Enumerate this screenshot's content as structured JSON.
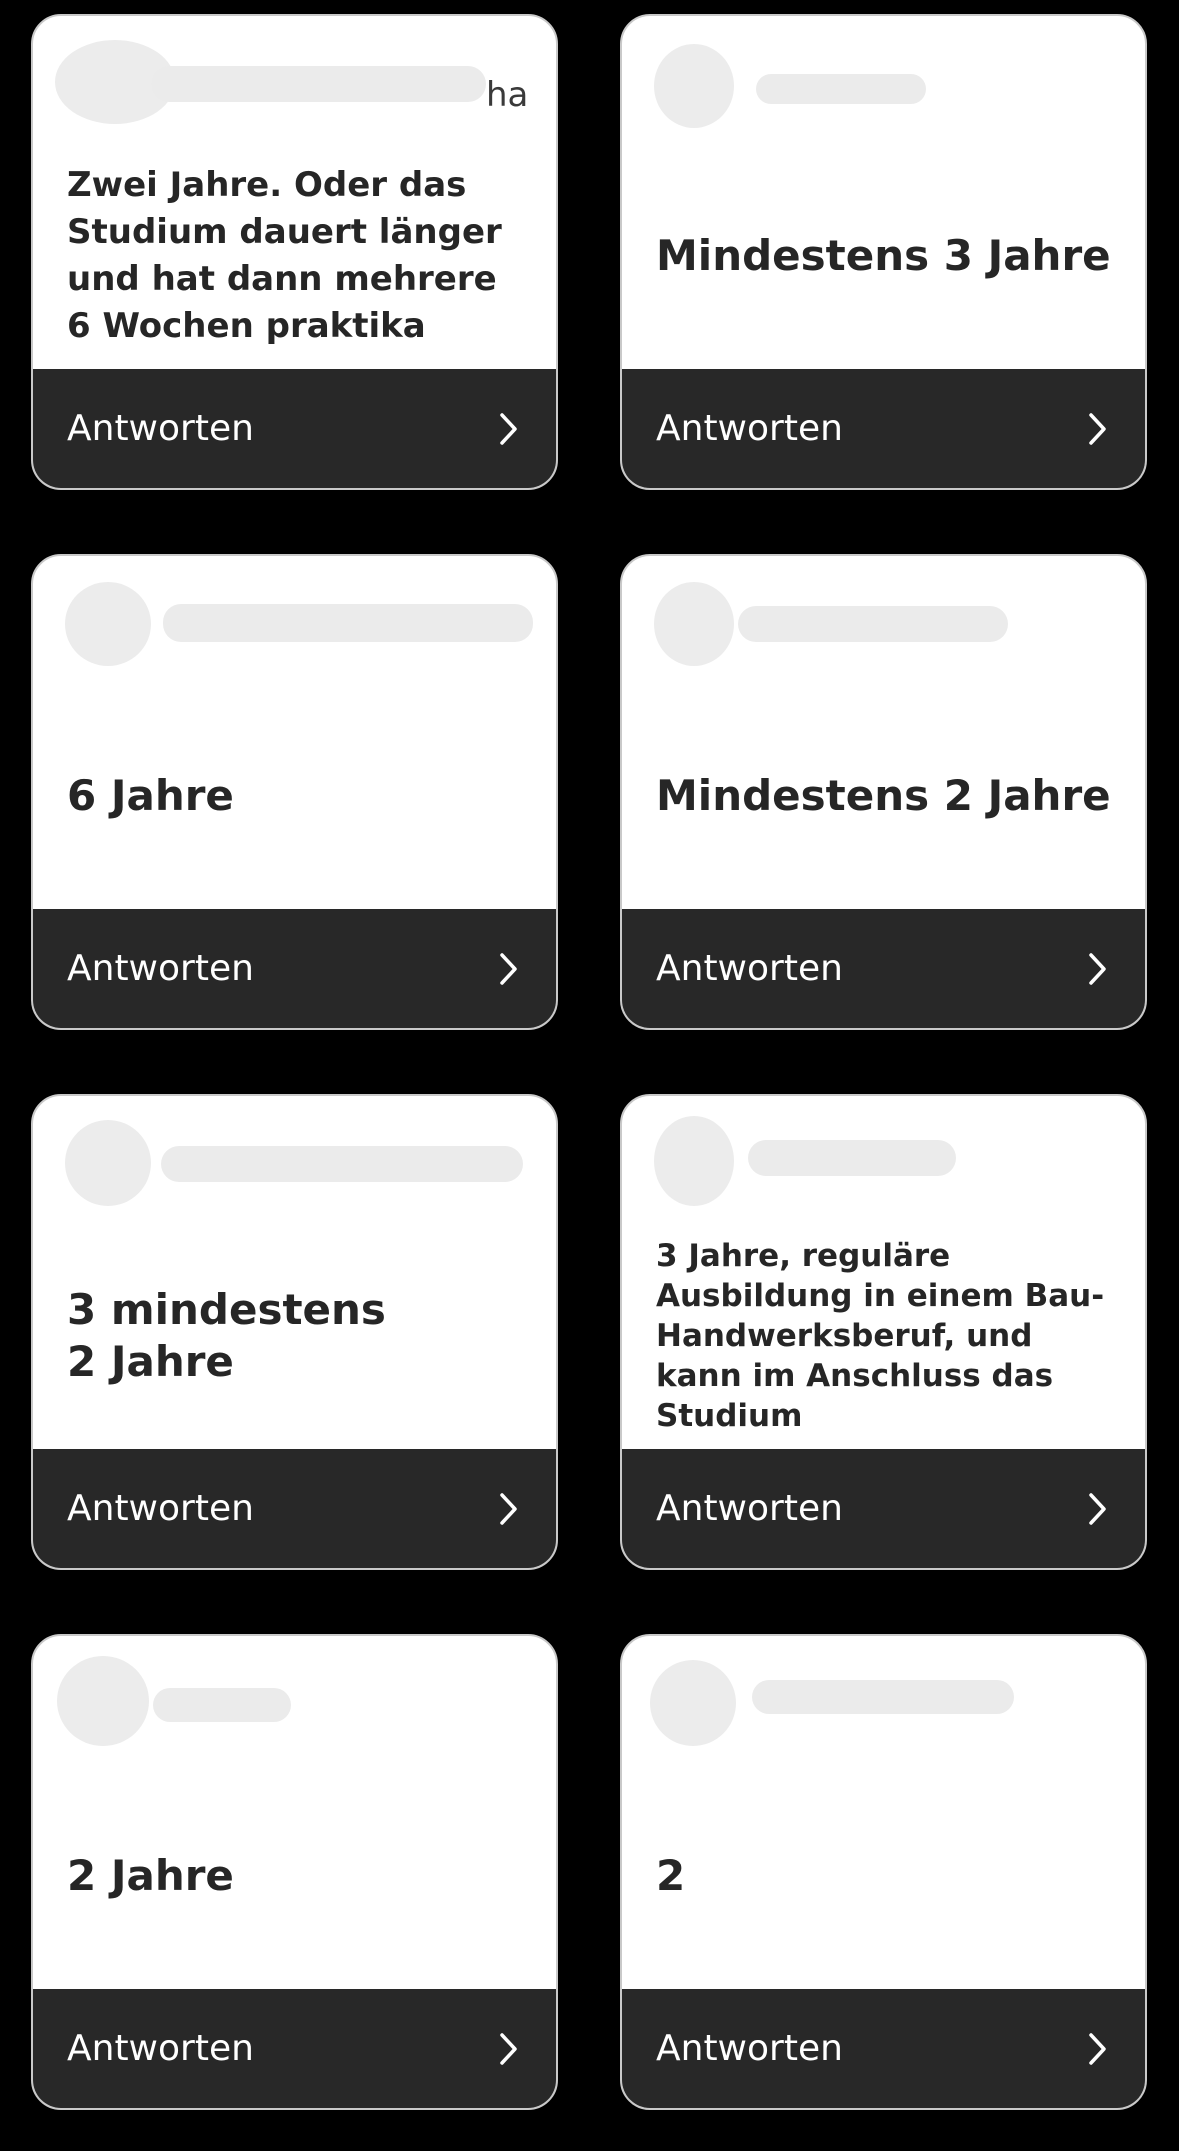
{
  "cards": [
    {
      "username_visible": "ha",
      "answer": "Zwei Jahre. Oder das Studium dauert länger und hat dann mehrere 6 Wochen praktika",
      "reply_label": "Antworten"
    },
    {
      "username_visible": "",
      "answer": "Mindestens 3 Jahre",
      "reply_label": "Antworten"
    },
    {
      "username_visible": "",
      "answer": "6 Jahre",
      "reply_label": "Antworten"
    },
    {
      "username_visible": "",
      "answer": "Mindestens 2 Jahre",
      "reply_label": "Antworten"
    },
    {
      "username_visible": "",
      "answer": "3 mindestens\n2 Jahre",
      "reply_label": "Antworten"
    },
    {
      "username_visible": "",
      "answer": "3 Jahre, reguläre Ausbildung in einem Bau-Handwerksberuf, und kann im Anschluss das Studium",
      "reply_label": "Antworten"
    },
    {
      "username_visible": "",
      "answer": "2 Jahre",
      "reply_label": "Antworten"
    },
    {
      "username_visible": "",
      "answer": "2",
      "reply_label": "Antworten"
    }
  ]
}
